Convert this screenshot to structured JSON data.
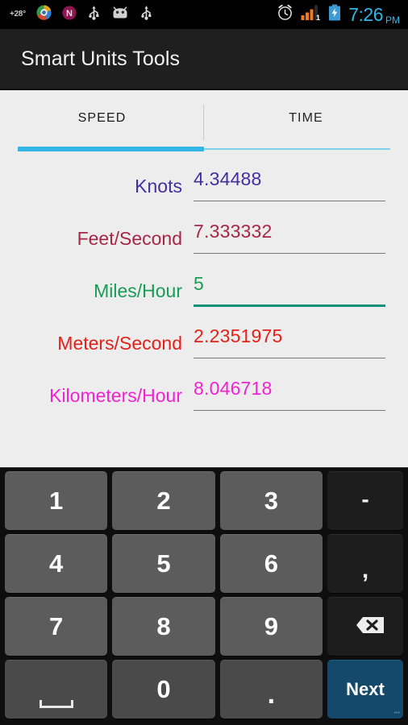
{
  "status_bar": {
    "temperature": "+28°",
    "left_icons": [
      {
        "name": "weather-temp-indicator",
        "glyph": "+28°"
      },
      {
        "name": "browser-notification-icon",
        "glyph": "◉"
      },
      {
        "name": "onenote-notification-icon",
        "glyph": "N"
      },
      {
        "name": "usb-debugging-icon",
        "glyph": "usb"
      },
      {
        "name": "android-system-icon",
        "glyph": "android"
      },
      {
        "name": "usb-connected-icon",
        "glyph": "usb"
      }
    ],
    "right_icons": [
      {
        "name": "alarm-icon",
        "glyph": "alarm"
      },
      {
        "name": "signal-strength-icon",
        "glyph": "signal",
        "level": "1"
      },
      {
        "name": "battery-charging-icon",
        "glyph": "battery"
      }
    ],
    "clock": {
      "time": "7:26",
      "ampm": "PM"
    },
    "signal_level_label": "1",
    "colors": {
      "accent": "#33b5e5",
      "background": "#000000"
    }
  },
  "action_bar": {
    "title": "Smart Units Tools",
    "background": "#1f1f1f",
    "text_color": "#f2f2f2"
  },
  "tabs": {
    "active_index": 0,
    "items": [
      {
        "label": "SPEED",
        "active": true
      },
      {
        "label": "TIME",
        "active": false
      }
    ],
    "indicator_color": "#33b5e5"
  },
  "conversions": {
    "focused_index": 2,
    "rows": [
      {
        "label": "Knots",
        "value": "4.34488",
        "color": "#432fa0",
        "underline_color": "#7a7a7a",
        "focused": false
      },
      {
        "label": "Feet/Second",
        "value": "7.333332",
        "color": "#a6264a",
        "underline_color": "#7a7a7a",
        "focused": false
      },
      {
        "label": "Miles/Hour",
        "value": "5",
        "color": "#1a9b56",
        "underline_color": "#129279",
        "focused": true
      },
      {
        "label": "Meters/Second",
        "value": "2.2351975",
        "color": "#e32119",
        "underline_color": "#7a7a7a",
        "focused": false
      },
      {
        "label": "Kilometers/Hour",
        "value": "8.046718",
        "color": "#f122d4",
        "underline_color": "#7a7a7a",
        "focused": false
      }
    ]
  },
  "keyboard": {
    "rows": [
      [
        {
          "label": "1",
          "type": "digit",
          "name": "key-1"
        },
        {
          "label": "2",
          "type": "digit",
          "name": "key-2"
        },
        {
          "label": "3",
          "type": "digit",
          "name": "key-3"
        },
        {
          "label": "-",
          "type": "fn-minus",
          "name": "key-minus"
        }
      ],
      [
        {
          "label": "4",
          "type": "digit",
          "name": "key-4"
        },
        {
          "label": "5",
          "type": "digit",
          "name": "key-5"
        },
        {
          "label": "6",
          "type": "digit",
          "name": "key-6"
        },
        {
          "label": ",",
          "type": "fn-comma",
          "name": "key-comma"
        }
      ],
      [
        {
          "label": "7",
          "type": "digit",
          "name": "key-7"
        },
        {
          "label": "8",
          "type": "digit",
          "name": "key-8"
        },
        {
          "label": "9",
          "type": "digit",
          "name": "key-9"
        },
        {
          "label": "",
          "type": "backspace",
          "name": "key-backspace"
        }
      ],
      [
        {
          "label": "",
          "type": "space",
          "name": "key-space"
        },
        {
          "label": "0",
          "type": "zero",
          "name": "key-0"
        },
        {
          "label": ".",
          "type": "dot",
          "name": "key-period"
        },
        {
          "label": "Next",
          "type": "action",
          "name": "key-next"
        }
      ]
    ],
    "action_key_color": "#14496b",
    "digit_key_color": "#5c5c5c",
    "fn_key_color": "#1d1d1d"
  }
}
